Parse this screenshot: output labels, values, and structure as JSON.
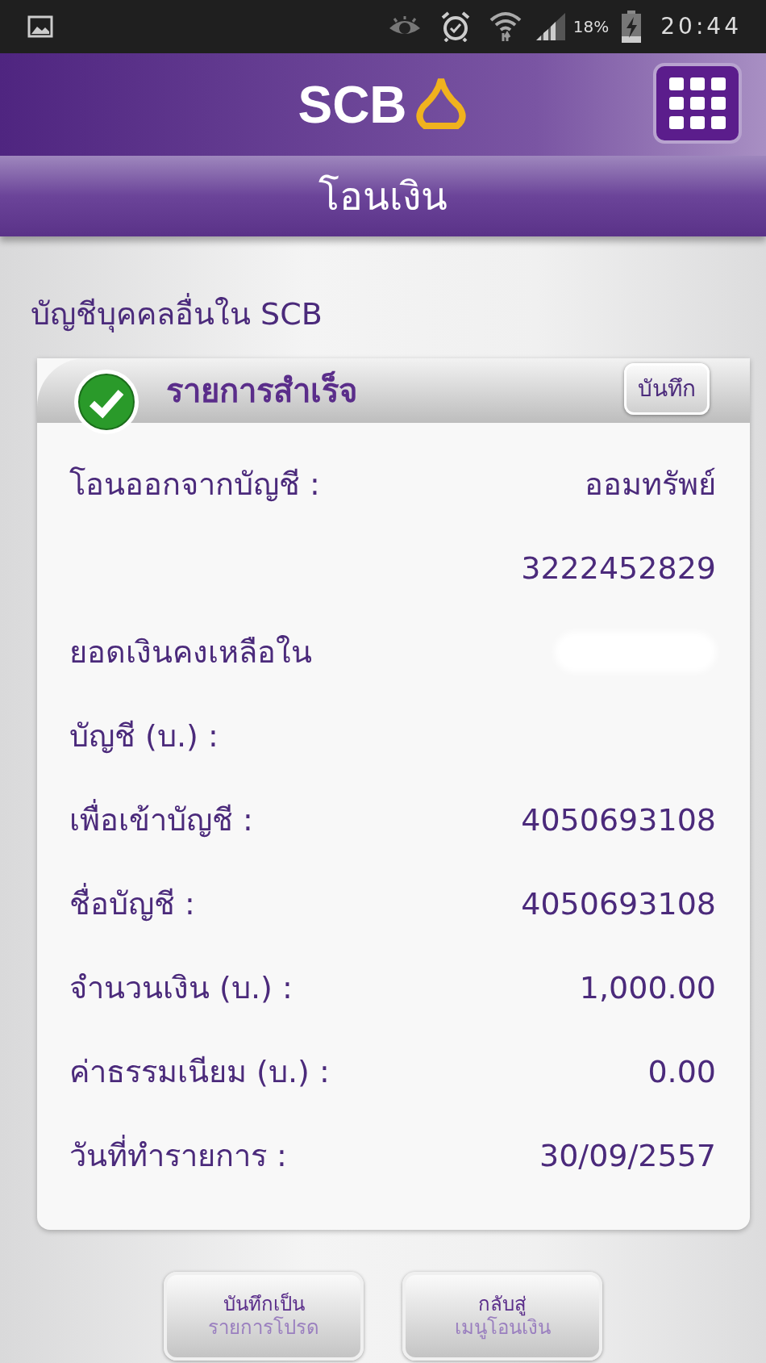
{
  "status_bar": {
    "battery": "18%",
    "time": "20:44"
  },
  "header": {
    "logo": "SCB",
    "title": "โอนเงิน"
  },
  "subtitle": "บัญชีบุคคลอื่นใน SCB",
  "card": {
    "title": "รายการสำเร็จ",
    "save_button": "บันทึก",
    "rows": [
      {
        "label": "โอนออกจากบัญชี :",
        "value": "ออมทรัพย์"
      },
      {
        "value": "3222452829"
      },
      {
        "label": "ยอดเงินคงเหลือใน",
        "value_hidden": true
      },
      {
        "label": "บัญชี (บ.) :"
      },
      {
        "label": "เพื่อเข้าบัญชี :",
        "value": "4050693108"
      },
      {
        "label": "ชื่อบัญชี :",
        "value": "4050693108"
      },
      {
        "label": "จำนวนเงิน (บ.) :",
        "value": "1,000.00"
      },
      {
        "label": "ค่าธรรมเนียม (บ.) :",
        "value": "0.00"
      },
      {
        "label": "วันที่ทำรายการ :",
        "value": "30/09/2557"
      }
    ]
  },
  "buttons": [
    {
      "line1": "บันทึกเป็น",
      "line2": "รายการโปรด"
    },
    {
      "line1": "กลับสู่",
      "line2": "เมนูโอนเงิน"
    }
  ]
}
